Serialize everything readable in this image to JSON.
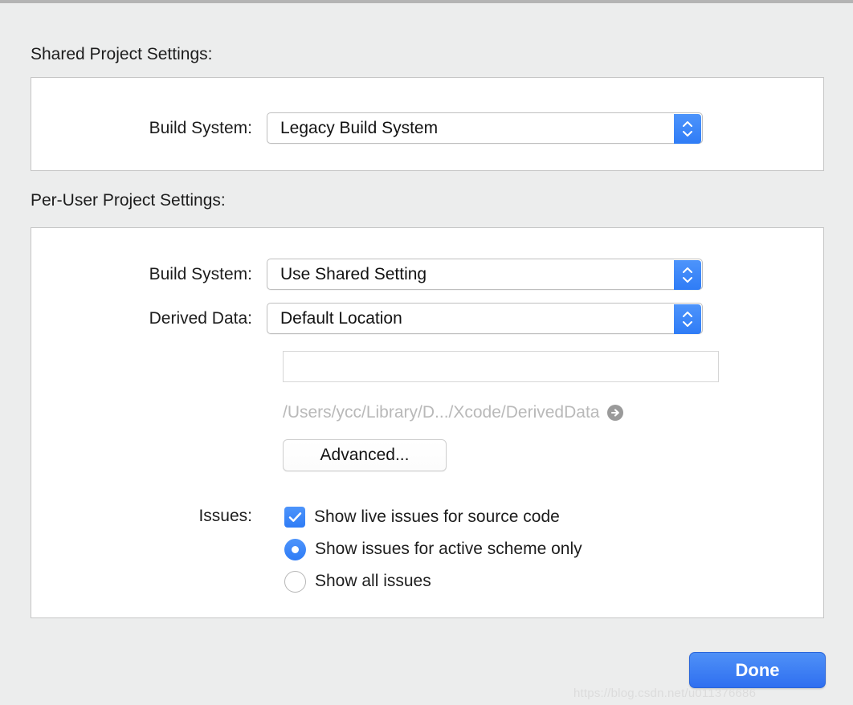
{
  "sections": {
    "shared": {
      "title": "Shared Project Settings:",
      "build_system": {
        "label": "Build System:",
        "value": "Legacy Build System"
      }
    },
    "per_user": {
      "title": "Per-User Project Settings:",
      "build_system": {
        "label": "Build System:",
        "value": "Use Shared Setting"
      },
      "derived_data": {
        "label": "Derived Data:",
        "value": "Default Location",
        "custom_path_value": "",
        "resolved_path": "/Users/ycc/Library/D.../Xcode/DerivedData",
        "reveal_icon": "arrow-right-circle-icon"
      },
      "advanced_button": "Advanced...",
      "issues": {
        "label": "Issues:",
        "show_live_issues": {
          "text": "Show live issues for source code",
          "checked": true
        },
        "options": [
          {
            "text": "Show issues for active scheme only",
            "selected": true
          },
          {
            "text": "Show all issues",
            "selected": false
          }
        ]
      }
    }
  },
  "footer": {
    "done_label": "Done"
  },
  "watermark": "https://blog.csdn.net/u011376686",
  "colors": {
    "accent_blue": "#2f7cf6",
    "window_bg": "#eceded",
    "box_bg": "#ffffff",
    "muted_text": "#b9b9b9"
  },
  "icons": {
    "stepper": "stepper-up-down-icon",
    "checkmark": "checkmark-icon"
  }
}
